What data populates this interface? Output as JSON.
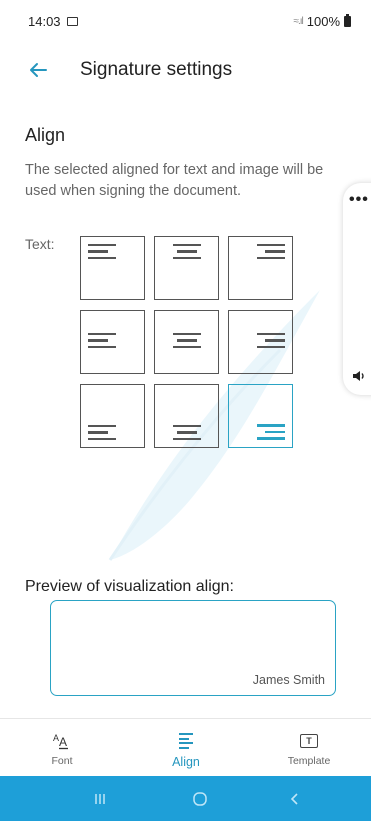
{
  "status_bar": {
    "time": "14:03",
    "battery": "100%"
  },
  "header": {
    "title": "Signature settings"
  },
  "section": {
    "title": "Align",
    "description": "The selected aligned for text and image will be used when signing the document."
  },
  "alignment": {
    "label": "Text:",
    "options": [
      "top-left",
      "top-center",
      "top-right",
      "middle-left",
      "middle-center",
      "middle-right",
      "bottom-left",
      "bottom-center",
      "bottom-right"
    ],
    "selected": "bottom-right",
    "selected_color": "#2aa3c4"
  },
  "preview": {
    "label": "Preview of visualization align:",
    "signature_name": "James Smith"
  },
  "bottom_nav": {
    "items": [
      {
        "label": "Font",
        "icon": "font-icon"
      },
      {
        "label": "Align",
        "icon": "align-icon"
      },
      {
        "label": "Template",
        "icon": "template-icon"
      }
    ],
    "active": "Align"
  },
  "colors": {
    "accent": "#2596be",
    "system_bar": "#1e9fd8"
  }
}
